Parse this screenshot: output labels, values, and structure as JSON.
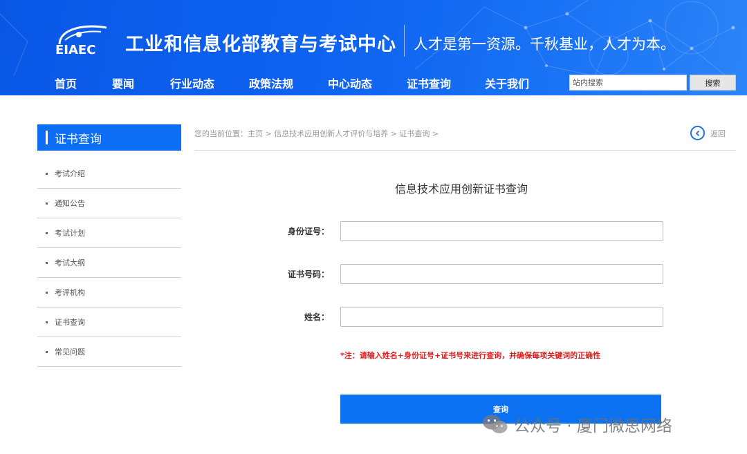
{
  "header": {
    "logo_text": "EIAEC",
    "title": "工业和信息化部教育与考试中心",
    "slogan": "人才是第一资源。千秋基业，人才为本。"
  },
  "nav": [
    "首页",
    "要闻",
    "行业动态",
    "政策法规",
    "中心动态",
    "证书查询",
    "关于我们"
  ],
  "search": {
    "placeholder": "站内搜索",
    "button": "搜索"
  },
  "sidebar": {
    "title": "证书查询",
    "items": [
      "考试介绍",
      "通知公告",
      "考试计划",
      "考试大纲",
      "考评机构",
      "证书查询",
      "常见问题"
    ]
  },
  "breadcrumb": "您的当前位置：主页 > 信息技术应用创新人才评价与培养 > 证书查询 >",
  "back_label": "返回",
  "form": {
    "title": "信息技术应用创新证书查询",
    "id_label": "身份证号：",
    "cert_label": "证书号码：",
    "name_label": "姓名：",
    "note": "*注：请输入姓名+身份证号+证书号来进行查询，并确保每项关键词的正确性",
    "submit": "查询"
  },
  "watermark": "公众号 · 厦门微思网络",
  "colors": {
    "header": "#0e63f0",
    "accent": "#0d6ef5",
    "note": "#e02020"
  }
}
